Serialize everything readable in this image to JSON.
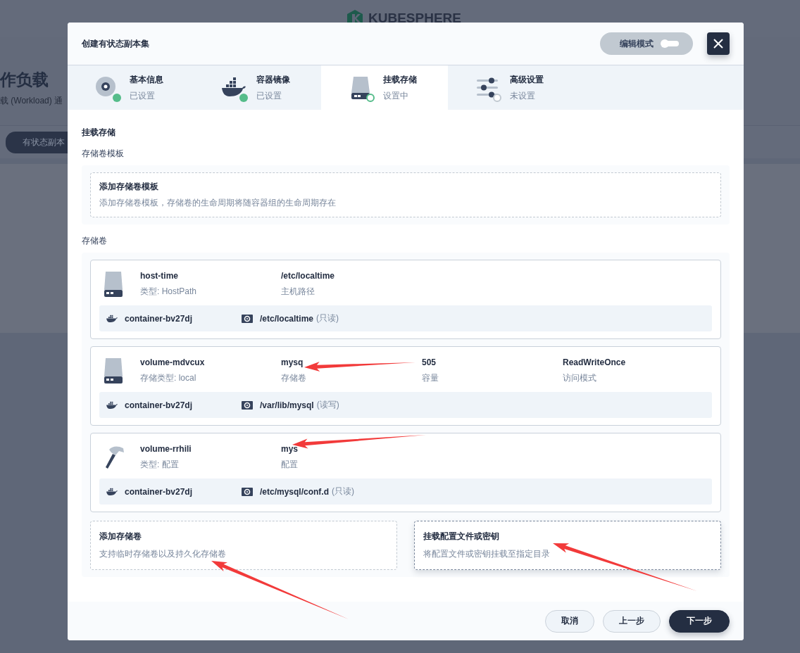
{
  "background": {
    "logo": "KUBESPHERE",
    "heading": "作负载",
    "subtitle": "载 (Workload) 通",
    "tab_button": "有状态副本"
  },
  "dialog": {
    "title": "创建有状态副本集",
    "edit_mode": {
      "label": "编辑模式",
      "on": false
    },
    "steps": [
      {
        "title": "基本信息",
        "status": "已设置",
        "kind": "info",
        "completed": true,
        "selected": false
      },
      {
        "title": "容器镜像",
        "status": "已设置",
        "kind": "image",
        "completed": true,
        "selected": false
      },
      {
        "title": "挂载存储",
        "status": "设置中",
        "kind": "storage",
        "completed": false,
        "selected": true
      },
      {
        "title": "高级设置",
        "status": "未设置",
        "kind": "advanced",
        "completed": false,
        "selected": false
      }
    ],
    "section_title": "挂载存储",
    "template_label": "存储卷模板",
    "template_add": {
      "title": "添加存储卷模板",
      "description": "添加存储卷模板，存储卷的生命周期将随容器组的生命周期存在"
    },
    "volumes_label": "存储卷",
    "volumes": [
      {
        "kind": "disk",
        "name": "host-time",
        "type": "类型: HostPath",
        "fields": [
          {
            "value": "/etc/localtime",
            "label": "主机路径"
          }
        ],
        "container": "container-bv27dj",
        "mount_path": "/etc/localtime",
        "mode": "(只读)"
      },
      {
        "kind": "disk",
        "name": "volume-mdvcux",
        "type": "存储类型: local",
        "fields": [
          {
            "value": "mysq",
            "label": "存储卷"
          },
          {
            "value": "505",
            "label": "容量"
          },
          {
            "value": "ReadWriteOnce",
            "label": "访问模式"
          }
        ],
        "container": "container-bv27dj",
        "mount_path": "/var/lib/mysql",
        "mode": "(读写)"
      },
      {
        "kind": "config",
        "name": "volume-rrhili",
        "type": "类型: 配置",
        "fields": [
          {
            "value": "mys",
            "label": "配置"
          }
        ],
        "container": "container-bv27dj",
        "mount_path": "/etc/mysql/conf.d",
        "mode": "(只读)"
      }
    ],
    "add_options": [
      {
        "title": "添加存储卷",
        "description": "支持临时存储卷以及持久化存储卷",
        "selected": false
      },
      {
        "title": "挂载配置文件或密钥",
        "description": "将配置文件或密钥挂载至指定目录",
        "selected": true
      }
    ],
    "buttons": [
      {
        "label": "取消",
        "kind": "secondary"
      },
      {
        "label": "上一步",
        "kind": "secondary"
      },
      {
        "label": "下一步",
        "kind": "primary"
      }
    ]
  }
}
